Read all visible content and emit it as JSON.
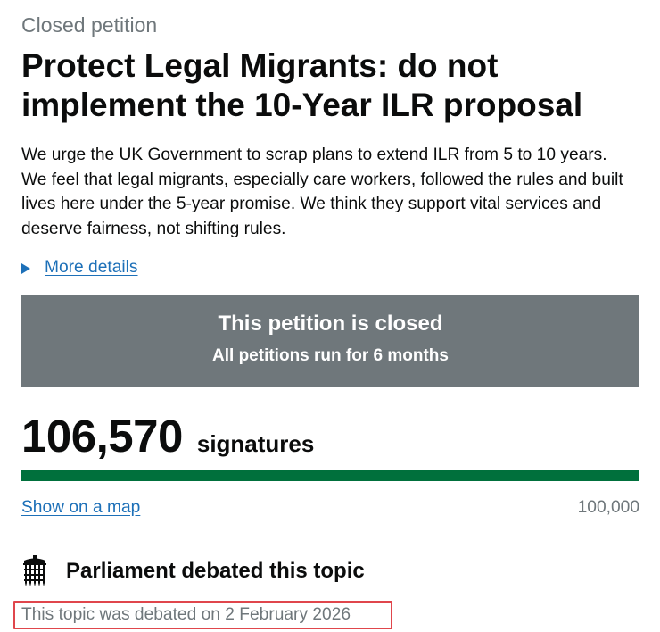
{
  "petition": {
    "status_label": "Closed petition",
    "title": "Protect Legal Migrants: do not implement the 10-Year ILR proposal",
    "summary": "We urge the UK Government to scrap plans to extend ILR from 5 to 10 years. We feel that legal migrants, especially care workers, followed the rules and built lives here under the 5-year promise. We think they support vital services and deserve fairness, not shifting rules.",
    "more_details_label": "More details"
  },
  "closed_panel": {
    "heading": "This petition is closed",
    "subtext": "All petitions run for 6 months"
  },
  "signatures": {
    "count": "106,570",
    "label": "signatures",
    "progress_fraction": 1.0,
    "target": "100,000"
  },
  "links": {
    "show_on_map": "Show on a map"
  },
  "debate": {
    "heading": "Parliament debated this topic",
    "note": "This topic was debated on 2 February 2026"
  },
  "colors": {
    "link": "#1d70b8",
    "panel": "#6f777b",
    "progress": "#00703c",
    "highlight_border": "#e0464c"
  },
  "icons": {
    "details_toggle": "triangle-right-icon",
    "debate": "portcullis-icon"
  }
}
